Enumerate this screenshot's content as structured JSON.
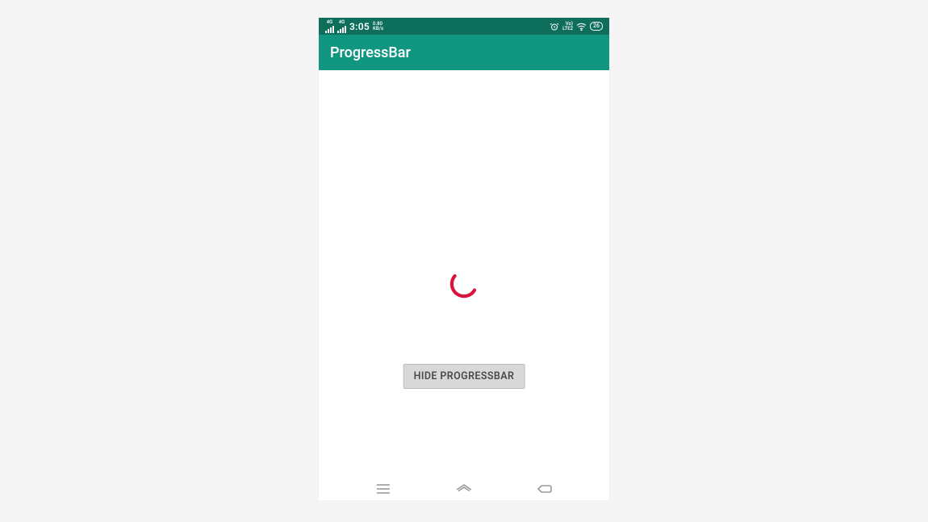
{
  "statusbar": {
    "network_label_1": "4G",
    "network_label_2": "4G",
    "time": "3:05",
    "data_speed": "0.80",
    "data_unit": "KB/s",
    "volte": "Vo)",
    "lte": "LTE2",
    "battery": "26"
  },
  "appbar": {
    "title": "ProgressBar"
  },
  "content": {
    "button_label": "HIDE PROGRESSBAR"
  },
  "colors": {
    "statusbar_bg": "#0e6e5c",
    "appbar_bg": "#119681",
    "spinner": "#d8143e",
    "button_bg": "#d8d8d8"
  }
}
